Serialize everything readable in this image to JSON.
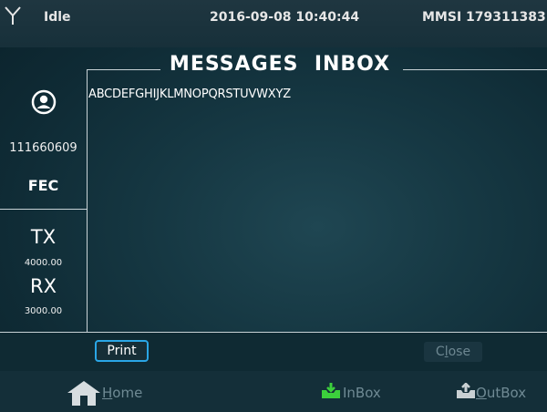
{
  "status": {
    "state": "Idle",
    "datetime": "2016-09-08 10:40:44",
    "mmsi": "MMSI 179311383",
    "icon": "antenna-icon"
  },
  "inbox": {
    "title": "MESSAGES  INBOX",
    "message_text": "ABCDEFGHIJKLMNOPQRSTUVWXYZ"
  },
  "station": {
    "icon": "contact-icon",
    "id": "111660609",
    "mode": "FEC",
    "tx_label": "TX",
    "tx_freq": "4000.00",
    "rx_label": "RX",
    "rx_freq": "3000.00"
  },
  "actions": {
    "print_label": "Print",
    "close_label": "Close"
  },
  "nav": {
    "home_label": "Home",
    "inbox_label": "InBox",
    "outbox_label": "OutBox"
  },
  "colors": {
    "accent_border": "#2aa6e6",
    "inbox_icon": "#3ccf3c",
    "disabled_text": "#6f8a94"
  }
}
